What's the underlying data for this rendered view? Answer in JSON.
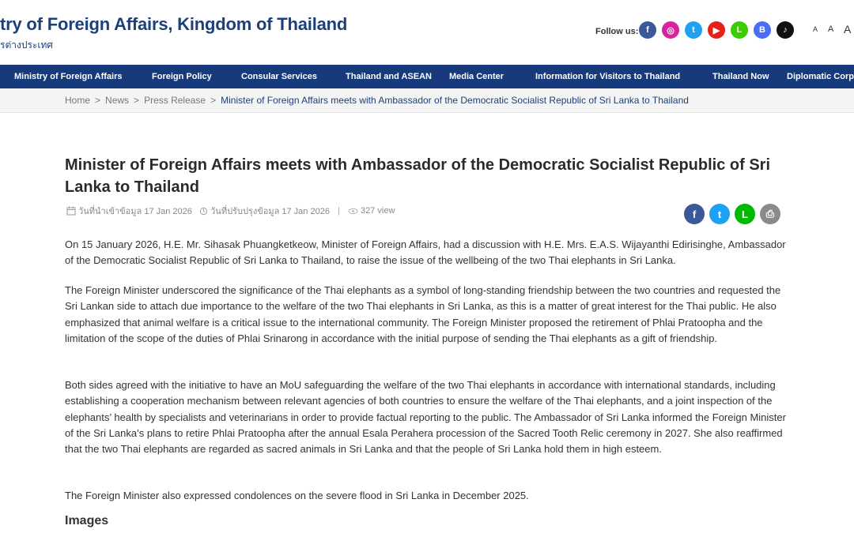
{
  "header": {
    "site_title": "try of Foreign Affairs, Kingdom of Thailand",
    "site_subtitle": "รต่างประเทศ",
    "follow_label": "Follow us:",
    "social": [
      {
        "name": "facebook-icon",
        "glyph": "f",
        "color": "#3b5998"
      },
      {
        "name": "instagram-icon",
        "glyph": "◎",
        "color": "#d6249f"
      },
      {
        "name": "twitter-icon",
        "glyph": "t",
        "color": "#1da1f2"
      },
      {
        "name": "youtube-icon",
        "glyph": "▶",
        "color": "#e62117"
      },
      {
        "name": "line-icon",
        "glyph": "L",
        "color": "#3acd01"
      },
      {
        "name": "blockdit-icon",
        "glyph": "B",
        "color": "#4a6cf7"
      },
      {
        "name": "tiktok-icon",
        "glyph": "♪",
        "color": "#111111"
      }
    ],
    "font_sizes": [
      "A",
      "A",
      "A"
    ]
  },
  "nav": {
    "items": [
      "Ministry of Foreign Affairs",
      "Foreign Policy",
      "Consular Services",
      "Thailand and ASEAN",
      "Media Center",
      "Information for Visitors to Thailand",
      "Thailand Now",
      "Diplomatic Corp"
    ]
  },
  "breadcrumb": {
    "items": [
      "Home",
      "News",
      "Press Release"
    ],
    "current": "Minister of Foreign Affairs meets with Ambassador of the Democratic Socialist Republic of Sri Lanka to Thailand",
    "separator": ">"
  },
  "article": {
    "title": "Minister of Foreign Affairs meets with Ambassador of the Democratic Socialist Republic of Sri Lanka to Thailand",
    "created": "วันที่นำเข้าข้อมูล 17 Jan 2026",
    "updated": "วันที่ปรับปรุงข้อมูล 17 Jan 2026",
    "views": "327 view",
    "share": [
      {
        "name": "share-facebook-icon",
        "glyph": "f",
        "color": "#3b5998"
      },
      {
        "name": "share-twitter-icon",
        "glyph": "t",
        "color": "#1da1f2"
      },
      {
        "name": "share-line-icon",
        "glyph": "L",
        "color": "#00b900"
      },
      {
        "name": "print-icon",
        "glyph": "⎙",
        "color": "#8a8a8a"
      }
    ],
    "paragraphs": [
      "On 15 January 2026, H.E. Mr. Sihasak Phuangketkeow, Minister of Foreign Affairs, had a discussion with H.E. Mrs. E.A.S. Wijayanthi Edirisinghe, Ambassador of the Democratic Socialist Republic of Sri Lanka to Thailand, to raise the issue of the wellbeing of the two Thai elephants in Sri Lanka.",
      "The Foreign Minister underscored the significance of the Thai elephants as a symbol of long-standing friendship between the two countries and requested the Sri Lankan side to attach due importance to the welfare of the two Thai elephants in Sri Lanka, as this is a matter of great interest for the Thai public. He also emphasized that animal welfare is a critical issue to the international community. The Foreign Minister proposed the retirement of Phlai Pratoopha and the limitation of the scope of the duties of Phlai Srinarong in accordance with the initial purpose of sending the Thai elephants as a gift of friendship.",
      "Both sides agreed with the initiative to have an MoU safeguarding the welfare of the two Thai elephants in accordance with international standards, including establishing a cooperation mechanism between relevant agencies of both countries to ensure the welfare of the Thai elephants, and a joint inspection of the elephants’ health by specialists and veterinarians in order to provide factual reporting to the public. The Ambassador of Sri Lanka informed the Foreign Minister of the Sri Lanka’s plans to retire Phlai Pratoopha after the annual Esala Perahera procession of the Sacred Tooth Relic ceremony in 2027. She also reaffirmed that the two Thai elephants are regarded as sacred animals in Sri Lanka and that the people of Sri Lanka hold them in high esteem.",
      "The Foreign Minister also expressed condolences on the severe flood in Sri Lanka in December 2025."
    ],
    "images_heading": "Images"
  }
}
